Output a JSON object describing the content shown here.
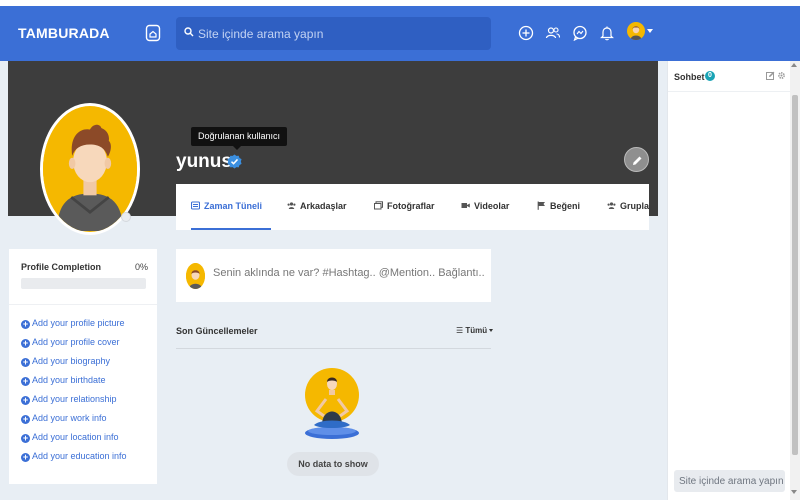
{
  "header": {
    "logo": "TAMBURADA",
    "search_placeholder": "Site içinde arama yapın"
  },
  "profile": {
    "username": "yunus",
    "verified_tooltip": "Doğrulanan kullanıcı"
  },
  "tabs": [
    {
      "label": "Zaman Tüneli",
      "icon": "timeline-icon",
      "active": true
    },
    {
      "label": "Arkadaşlar",
      "icon": "friends-icon",
      "active": false
    },
    {
      "label": "Fotoğraflar",
      "icon": "photos-icon",
      "active": false
    },
    {
      "label": "Videolar",
      "icon": "video-icon",
      "active": false
    },
    {
      "label": "Beğeni",
      "icon": "flag-icon",
      "active": false
    },
    {
      "label": "Gruplar",
      "icon": "groups-icon",
      "active": false
    }
  ],
  "completion": {
    "title": "Profile Completion",
    "percent_label": "0%",
    "progress": 0,
    "items": [
      "Add your profile picture",
      "Add your profile cover",
      "Add your biography",
      "Add your birthdate",
      "Add your relationship",
      "Add your work info",
      "Add your location info",
      "Add your education info"
    ]
  },
  "post": {
    "placeholder": "Senin aklında ne var? #Hashtag.. @Mention.. Bağlantı.."
  },
  "recent": {
    "title": "Son Güncellemeler",
    "filter_label": "Tümü",
    "empty_label": "No data to show"
  },
  "chat": {
    "title": "Sohbet",
    "count": "0",
    "search_placeholder": "Site içinde arama yapın"
  },
  "colors": {
    "brand": "#3b6fd6",
    "cover": "#3d3d3d",
    "avatar_bg": "#f5b800",
    "verified": "#3b8fe0",
    "chat_badge": "#1aa3b5"
  }
}
